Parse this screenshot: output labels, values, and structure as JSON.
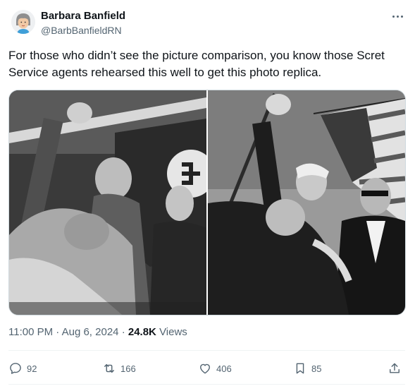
{
  "post": {
    "author": {
      "display_name": "Barbara Banfield",
      "handle": "@BarbBanfieldRN",
      "avatar_icon": "avatar-illustration-icon"
    },
    "more_icon": "more-options-icon",
    "text": "For those who didn’t see the picture comparison, you know those Scret Service agents rehearsed this well to get this photo replica.",
    "media": [
      {
        "icon": "historical-photo-left",
        "alt": ""
      },
      {
        "icon": "photo-right",
        "alt": ""
      }
    ],
    "meta": {
      "time": "11:00 PM",
      "separator": "·",
      "date": "Aug 6, 2024",
      "views_count": "24.8K",
      "views_label": "Views"
    },
    "actions": {
      "reply": {
        "icon": "reply-icon",
        "count": "92"
      },
      "repost": {
        "icon": "repost-icon",
        "count": "166"
      },
      "like": {
        "icon": "heart-icon",
        "count": "406"
      },
      "bookmark": {
        "icon": "bookmark-icon",
        "count": "85"
      },
      "share": {
        "icon": "share-icon"
      }
    }
  },
  "colors": {
    "text_primary": "#0f1419",
    "text_secondary": "#536471",
    "border": "#cfd9de"
  }
}
